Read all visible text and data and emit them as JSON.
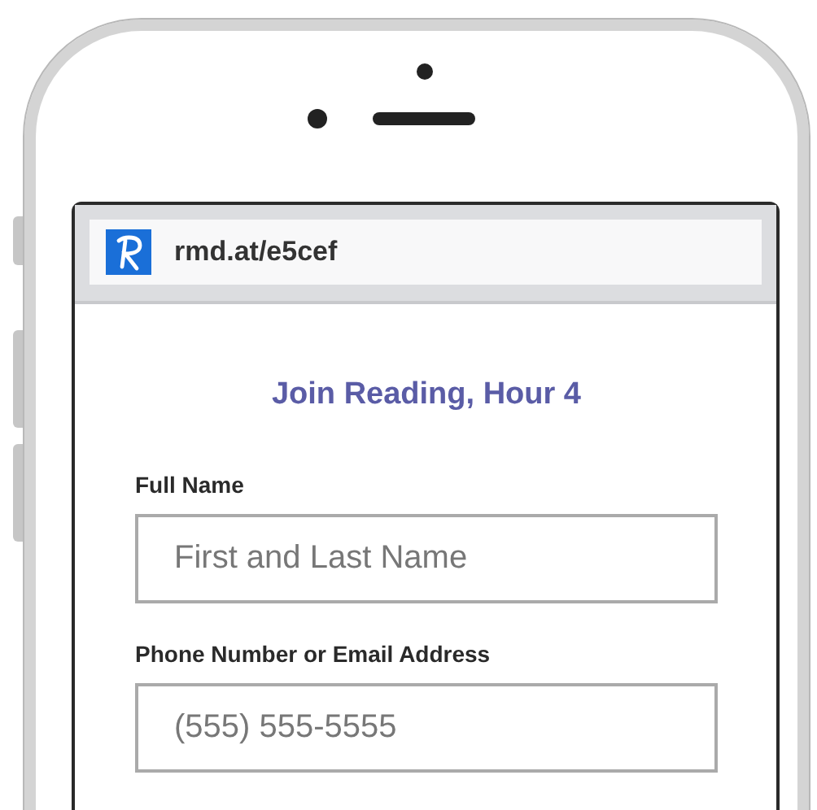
{
  "browser": {
    "url": "rmd.at/e5cef"
  },
  "form": {
    "title": "Join Reading, Hour 4",
    "fields": [
      {
        "label": "Full Name",
        "placeholder": "First and Last Name"
      },
      {
        "label": "Phone Number or Email Address",
        "placeholder": "(555) 555-5555"
      }
    ]
  }
}
